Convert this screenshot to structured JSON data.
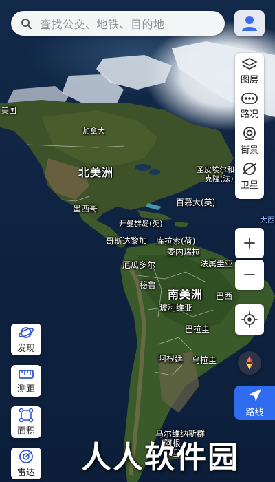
{
  "search": {
    "placeholder": "查找公交、地铁、目的地"
  },
  "layers": [
    {
      "label": "图层",
      "icon": "layers-icon"
    },
    {
      "label": "路况",
      "icon": "traffic-icon"
    },
    {
      "label": "街景",
      "icon": "street-view-icon"
    },
    {
      "label": "卫星",
      "icon": "satellite-icon"
    }
  ],
  "tools": [
    {
      "label": "发现",
      "icon": "discover-planet-icon"
    },
    {
      "label": "测距",
      "icon": "ruler-icon"
    },
    {
      "label": "面积",
      "icon": "area-icon"
    },
    {
      "label": "雷达",
      "icon": "radar-icon"
    }
  ],
  "route": {
    "label": "路线"
  },
  "places": {
    "meiguo": "美国",
    "canada": "加拿大",
    "north_america": "北美洲",
    "st_pierre": "圣皮埃尔和密",
    "st_pierre_2": "克隆(法)",
    "mexico": "墨西哥",
    "bermuda": "百慕大(英)",
    "atlantic": "大西",
    "cayman": "开曼群岛(英)",
    "costa_rica": "哥斯达黎加",
    "curacao": "库拉索(荷)",
    "venezuela": "委内瑞拉",
    "ecuador": "厄瓜多尔",
    "french_guiana": "法属圭亚",
    "peru": "秘鲁",
    "south_america": "南美洲",
    "brazil": "巴西",
    "bolivia": "玻利维亚",
    "paraguay": "巴拉圭",
    "argentina": "阿根廷",
    "uruguay": "乌拉圭",
    "falklands": "马尔维纳斯群",
    "falklands_2": "(阿根",
    "falklands_3": "廷)"
  },
  "watermark": "人人软件园",
  "colors": {
    "accent": "#2f6cf0",
    "avatar": "#3b6cf0"
  }
}
